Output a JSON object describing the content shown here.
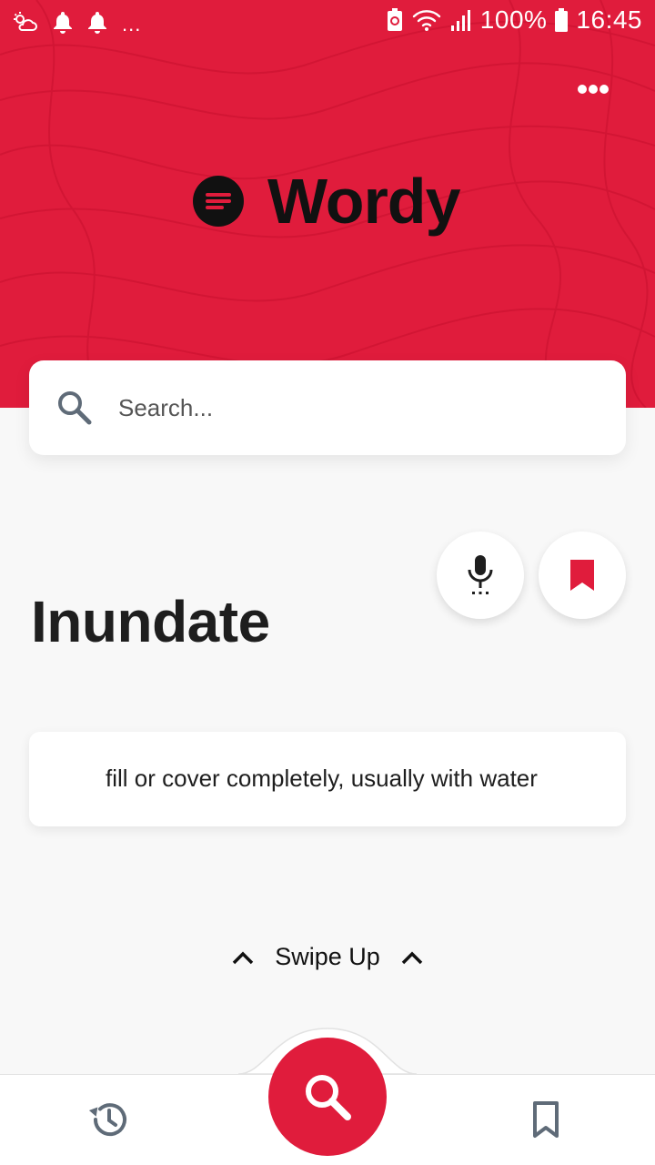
{
  "status_bar": {
    "overflow_dots": "...",
    "battery": "100%",
    "time": "16:45",
    "icons": [
      "weather-icon",
      "notification-bell-icon",
      "notification-bell-icon",
      "battery-saver-icon",
      "wifi-icon",
      "signal-icon",
      "battery-icon"
    ]
  },
  "header": {
    "app_name": "Wordy",
    "menu_icon": "more-horizontal-icon"
  },
  "search": {
    "placeholder": "Search...",
    "icon": "search-icon"
  },
  "actions": {
    "mic_icon": "microphone-icon",
    "bookmark_icon": "bookmark-icon"
  },
  "word": {
    "title": "Inundate",
    "definition": "fill or cover completely, usually with water"
  },
  "swipe": {
    "label": "Swipe Up"
  },
  "bottom_nav": {
    "items": [
      "history-icon",
      "search-icon",
      "bookmark-outline-icon"
    ]
  },
  "colors": {
    "brand": "#e01c3c",
    "background": "#f8f8f8",
    "card": "#ffffff",
    "icon_gray": "#5f6b78"
  }
}
